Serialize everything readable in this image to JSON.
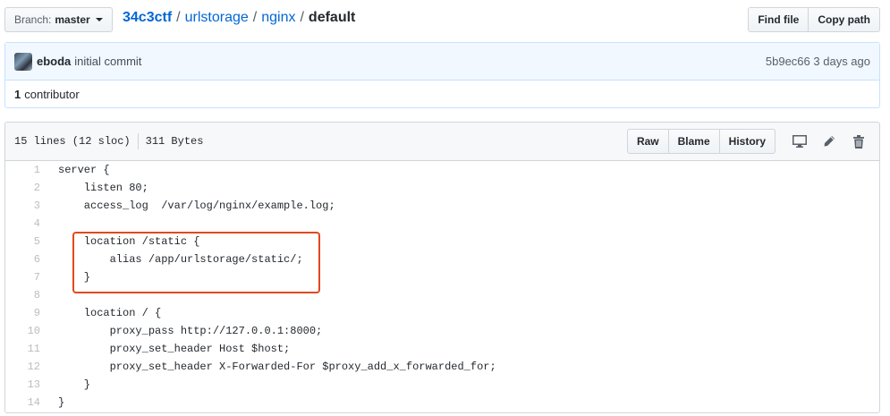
{
  "branch": {
    "prefix": "Branch:",
    "name": "master"
  },
  "breadcrumb": {
    "root": "34c3ctf",
    "sep": "/",
    "parts": [
      "urlstorage",
      "nginx"
    ],
    "current": "default"
  },
  "top_actions": {
    "find_file": "Find file",
    "copy_path": "Copy path"
  },
  "commit": {
    "author": "eboda",
    "message": "initial commit",
    "sha": "5b9ec66",
    "time": "3 days ago"
  },
  "contributors": {
    "count": "1",
    "label": "contributor"
  },
  "file": {
    "lines_info": "15 lines (12 sloc)",
    "size": "311 Bytes",
    "raw": "Raw",
    "blame": "Blame",
    "history": "History"
  },
  "code_lines": [
    {
      "n": "1",
      "text": "server {"
    },
    {
      "n": "2",
      "text": "    listen 80;"
    },
    {
      "n": "3",
      "text": "    access_log  /var/log/nginx/example.log;"
    },
    {
      "n": "4",
      "text": ""
    },
    {
      "n": "5",
      "text": "    location /static {"
    },
    {
      "n": "6",
      "text": "        alias /app/urlstorage/static/;"
    },
    {
      "n": "7",
      "text": "    }"
    },
    {
      "n": "8",
      "text": ""
    },
    {
      "n": "9",
      "text": "    location / {"
    },
    {
      "n": "10",
      "text": "        proxy_pass http://127.0.0.1:8000;"
    },
    {
      "n": "11",
      "text": "        proxy_set_header Host $host;"
    },
    {
      "n": "12",
      "text": "        proxy_set_header X-Forwarded-For $proxy_add_x_forwarded_for;"
    },
    {
      "n": "13",
      "text": "    }"
    },
    {
      "n": "14",
      "text": "}"
    }
  ],
  "colors": {
    "link": "#0366d6",
    "highlight": "#e0491e",
    "commit_bg": "#f1f8ff"
  },
  "icons": [
    "caret-down-icon",
    "avatar",
    "desktop-icon",
    "pencil-icon",
    "trash-icon"
  ]
}
